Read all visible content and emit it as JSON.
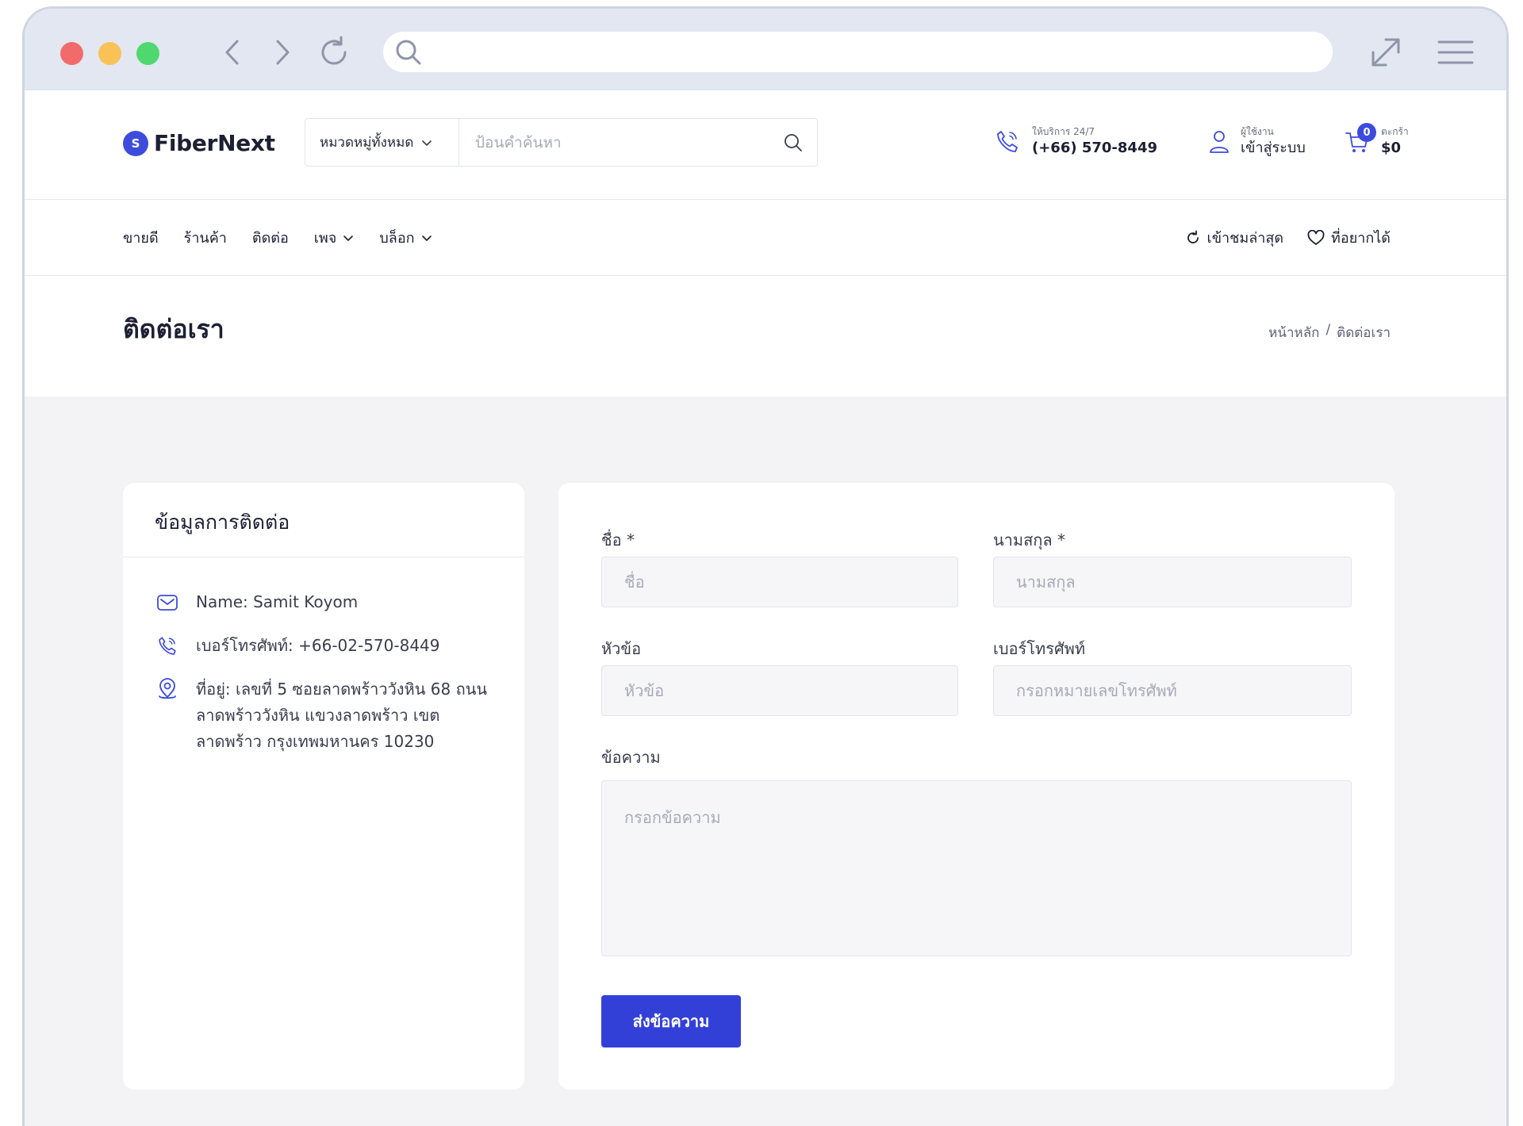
{
  "brand": {
    "name": "FiberNext",
    "mark": "S"
  },
  "search": {
    "category": "หมวดหมู่ทั้งหมด",
    "placeholder": "ป้อนคำค้นหา"
  },
  "contact_header": {
    "caption": "ให้บริการ 24/7",
    "phone": "(+66) 570-8449"
  },
  "account": {
    "caption": "ผู้ใช้งาน",
    "label": "เข้าสู่ระบบ"
  },
  "cart": {
    "count": "0",
    "caption": "ตะกร้า",
    "total": "$0"
  },
  "nav": {
    "items": [
      {
        "label": "ขายดี",
        "dropdown": false
      },
      {
        "label": "ร้านค้า",
        "dropdown": false
      },
      {
        "label": "ติดต่อ",
        "dropdown": false
      },
      {
        "label": "เพจ",
        "dropdown": true
      },
      {
        "label": "บล็อก",
        "dropdown": true
      }
    ],
    "recent": "เข้าชมล่าสุด",
    "wishlist": "ที่อยากได้"
  },
  "page": {
    "title": "ติดต่อเรา",
    "breadcrumb": {
      "home": "หน้าหลัก",
      "separator": "/",
      "current": "ติดต่อเรา"
    }
  },
  "info": {
    "title": "ข้อมูลการติดต่อ",
    "name": "Name: Samit Koyom",
    "phone": "เบอร์โทรศัพท์: +66-02-570-8449",
    "address": "ที่อยู่: เลขที่ 5 ซอยลาดพร้าววังหิน 68 ถนนลาดพร้าววังหิน แขวงลาดพร้าว เขตลาดพร้าว กรุงเทพมหานคร 10230"
  },
  "form": {
    "first_name": {
      "label": "ชื่อ *",
      "placeholder": "ชื่อ",
      "value": ""
    },
    "last_name": {
      "label": "นามสกุล *",
      "placeholder": "นามสกุล",
      "value": ""
    },
    "subject": {
      "label": "หัวข้อ",
      "placeholder": "หัวข้อ",
      "value": ""
    },
    "phone": {
      "label": "เบอร์โทรศัพท์",
      "placeholder": "กรอกหมายเลขโทรศัพท์",
      "value": ""
    },
    "message": {
      "label": "ข้อความ",
      "placeholder": "กรอกข้อความ",
      "value": ""
    },
    "submit": "ส่งข้อความ"
  },
  "colors": {
    "accent": "#3340d8",
    "chrome": "#e2e7f1",
    "content_bg": "#f3f3f5"
  }
}
